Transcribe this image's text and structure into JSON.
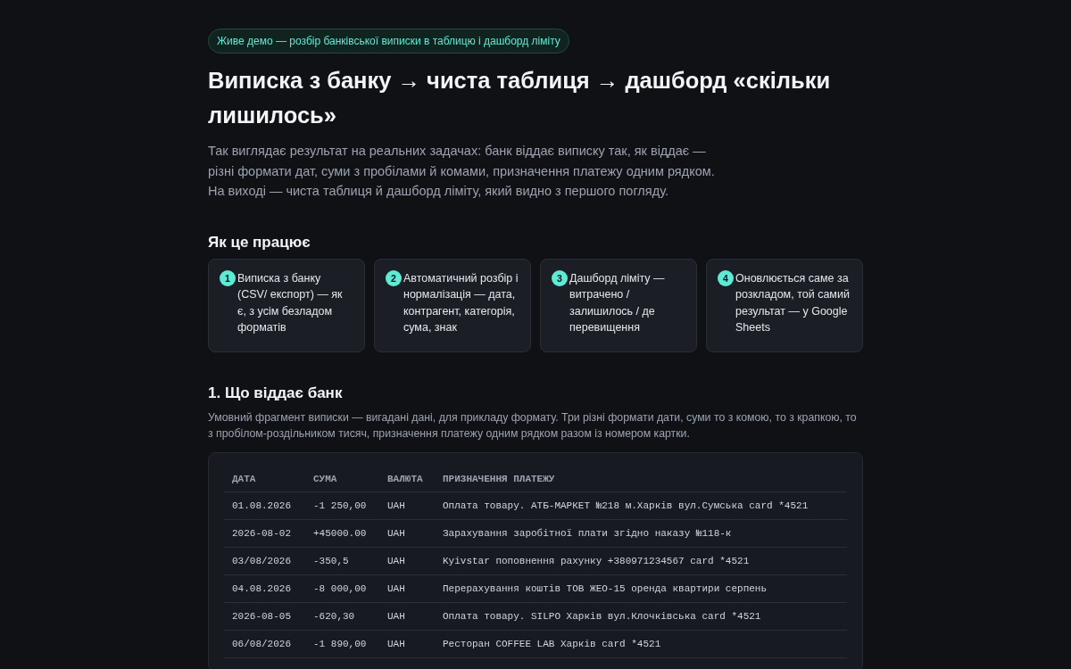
{
  "badge": "Живе демо — розбір банківської виписки в таблицю і дашборд ліміту",
  "title": "Виписка з банку → чиста таблиця → дашборд «скільки лишилось»",
  "intro": [
    "Так виглядає результат на реальних задачах: банк віддає виписку так, як віддає —",
    "різні формати дат, суми з пробілами й комами, призначення платежу одним рядком.",
    "На виході — чиста таблиця й дашборд ліміту, який видно з першого погляду."
  ],
  "how": {
    "heading": "Як це працює",
    "steps": [
      {
        "number": "1",
        "text": "Виписка з банку (CSV/ експорт) — як є, з усім безладом форматів"
      },
      {
        "number": "2",
        "text": "Автоматичний розбір і нормалізація — дата, контрагент, категорія, сума, знак"
      },
      {
        "number": "3",
        "text": "Дашборд ліміту — витрачено / залишилось / де перевищення"
      },
      {
        "number": "4",
        "text": "Оновлюється саме за розкладом, той самий результат — у Google Sheets"
      }
    ]
  },
  "section": {
    "heading": "1. Що віддає банк",
    "description": "Умовний фрагмент виписки — вигадані дані, для прикладу формату. Три різні формати дати, суми то з комою, то з крапкою, то з пробілом-роздільником тисяч, призначення платежу одним рядком разом із номером картки.",
    "table": {
      "columns": [
        "ДАТА",
        "СУМА",
        "ВАЛЮТА",
        "ПРИЗНАЧЕННЯ ПЛАТЕЖУ"
      ],
      "rows": [
        [
          "01.08.2026",
          "-1 250,00",
          "UAH",
          "Оплата товару. АТБ-МАРКЕТ №218 м.Харків вул.Сумська card *4521"
        ],
        [
          "2026-08-02",
          "+45000.00",
          "UAH",
          "Зарахування заробітної плати згідно наказу №118-к"
        ],
        [
          "03/08/2026",
          "-350,5",
          "UAH",
          "Kyivstar поповнення рахунку +380971234567 card *4521"
        ],
        [
          "04.08.2026",
          "-8 000,00",
          "UAH",
          "Перерахування коштів ТОВ ЖЕО-15 оренда квартири серпень"
        ],
        [
          "2026-08-05",
          "-620,30",
          "UAH",
          "Оплата товару. SILPO Харків вул.Клочківська card *4521"
        ],
        [
          "06/08/2026",
          "-1 890,00",
          "UAH",
          "Ресторан COFFEE LAB Харків card *4521"
        ]
      ]
    }
  }
}
